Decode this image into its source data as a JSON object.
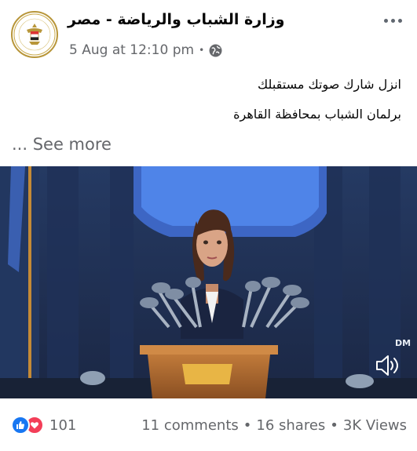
{
  "post": {
    "page_name": "وزارة الشباب والرياضة - مصر",
    "timestamp": "5 Aug at 12:10 pm",
    "separator": "•",
    "audience_icon": "globe-icon",
    "more_icon": "more-options-icon",
    "text_lines": [
      "انزل شارك صوتك مستقبلك",
      "برلمان الشباب بمحافظة القاهرة"
    ],
    "see_more": "... See more"
  },
  "video": {
    "watermark": "DM",
    "mute_icon": "speaker-icon"
  },
  "footer": {
    "reaction_icons": [
      "like-icon",
      "love-icon"
    ],
    "reaction_count": "101",
    "comments": "11 comments",
    "shares": "16 shares",
    "views": "3K Views",
    "dot": "•"
  },
  "colors": {
    "like": "#1877f2",
    "love": "#f33e58",
    "secondary_text": "#65676b"
  }
}
